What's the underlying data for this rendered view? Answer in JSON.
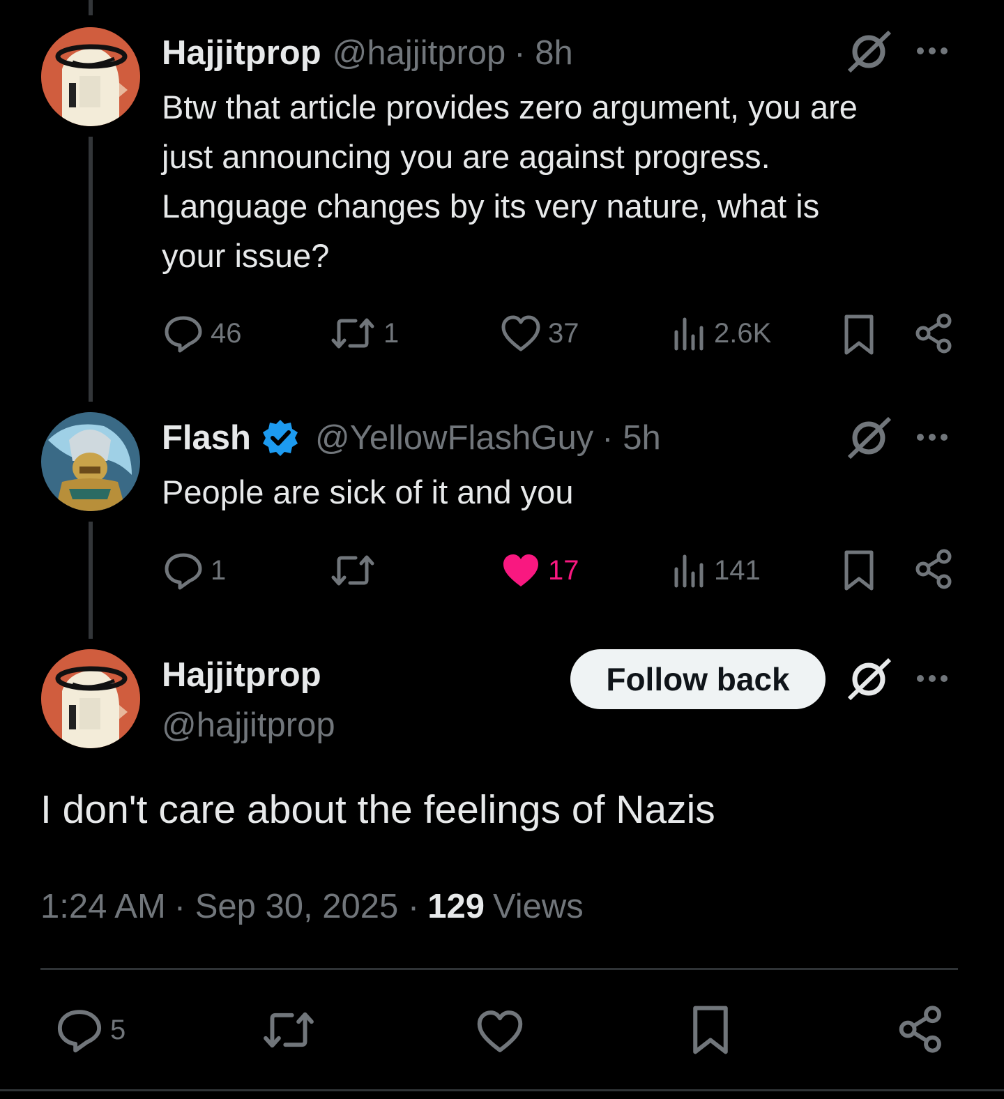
{
  "colors": {
    "background": "#000000",
    "text": "#e7e9ea",
    "muted": "#71767b",
    "like_active": "#f91880",
    "verified": "#1d9bf0"
  },
  "tweet1": {
    "name": "Hajjitprop",
    "handle": "@hajjitprop",
    "time": "· 8h",
    "lines": [
      "Btw that article provides zero argument, you are",
      "just announcing you are against progress.",
      "Language changes by its very nature, what is",
      "your issue?"
    ],
    "replies": "46",
    "reposts": "1",
    "likes": "37",
    "views": "2.6K"
  },
  "tweet2": {
    "name": "Flash",
    "verified_icon": "verified-badge-icon",
    "handle": "@YellowFlashGuy",
    "time": "· 5h",
    "text": "People are sick of it and you",
    "replies": "1",
    "likes": "17",
    "liked": true,
    "views": "141"
  },
  "main_tweet": {
    "name": "Hajjitprop",
    "handle": "@hajjitprop",
    "follow_label": "Follow back",
    "text": "I don't care about the feelings of Nazis",
    "time": "1:24 AM",
    "date": "· Sep 30, 2025 ·",
    "views_count": "129",
    "views_label": "Views",
    "replies": "5"
  }
}
